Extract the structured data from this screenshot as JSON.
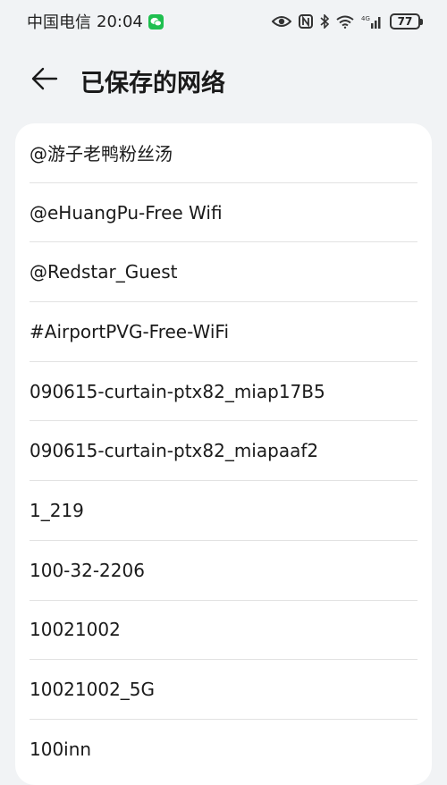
{
  "status_bar": {
    "carrier": "中国电信",
    "time": "20:04",
    "battery": "77",
    "network_type": "4G"
  },
  "header": {
    "title": "已保存的网络",
    "back_icon": "arrow-left-icon"
  },
  "networks": [
    {
      "name": "@游子老鸭粉丝汤"
    },
    {
      "name": "@eHuangPu-Free Wifi"
    },
    {
      "name": "@Redstar_Guest"
    },
    {
      "name": "#AirportPVG-Free-WiFi"
    },
    {
      "name": "090615-curtain-ptx82_miap17B5"
    },
    {
      "name": "090615-curtain-ptx82_miapaaf2"
    },
    {
      "name": "1_219"
    },
    {
      "name": "100-32-2206"
    },
    {
      "name": "10021002"
    },
    {
      "name": "10021002_5G"
    },
    {
      "name": "100inn"
    }
  ],
  "colors": {
    "background": "#f1f3f5",
    "card": "#ffffff",
    "divider": "#e2e2e2",
    "wechat_green": "#1fbf4f"
  }
}
